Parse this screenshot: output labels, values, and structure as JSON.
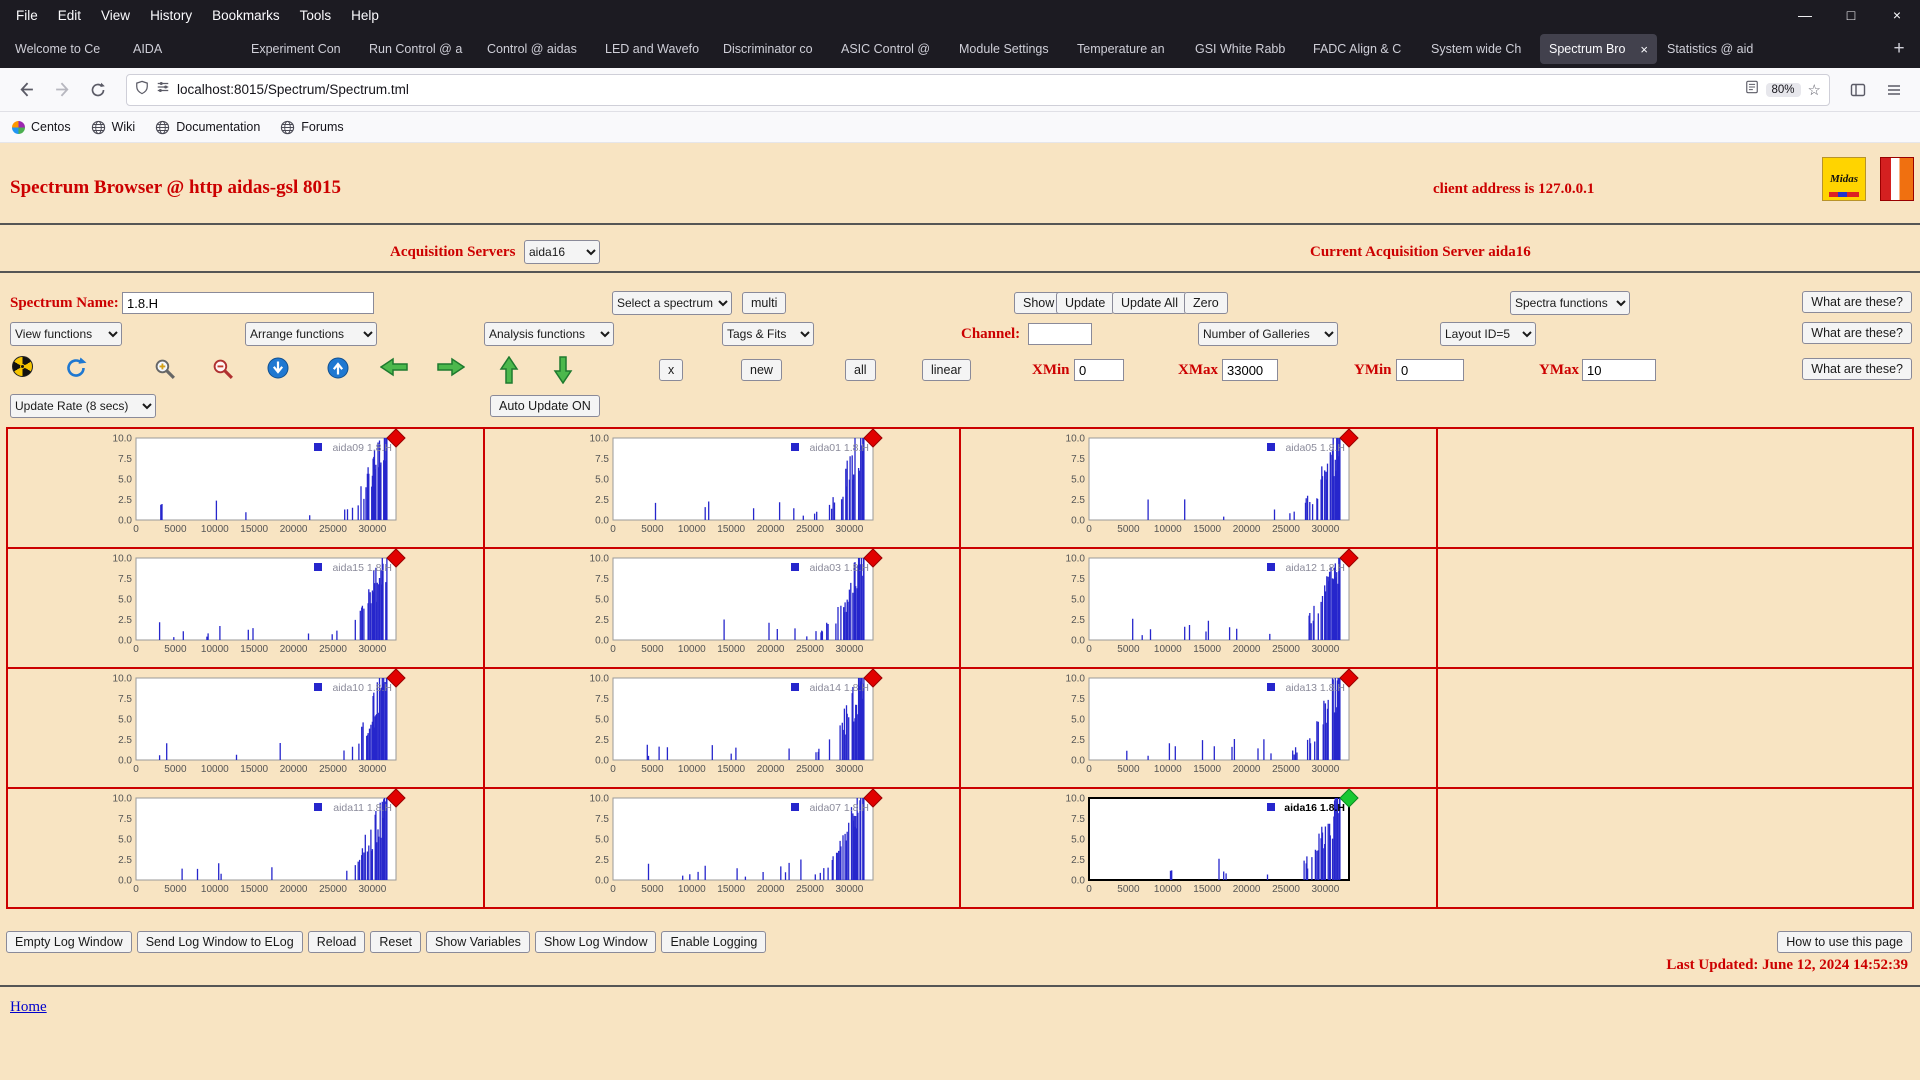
{
  "browser": {
    "menu": [
      "File",
      "Edit",
      "View",
      "History",
      "Bookmarks",
      "Tools",
      "Help"
    ],
    "window_controls": {
      "minimize": "—",
      "maximize": "□",
      "close": "×"
    },
    "tabs": [
      {
        "label": "Welcome to Ce"
      },
      {
        "label": "AIDA"
      },
      {
        "label": "Experiment Con"
      },
      {
        "label": "Run Control @ a"
      },
      {
        "label": "Control @ aidas"
      },
      {
        "label": "LED and Wavefo"
      },
      {
        "label": "Discriminator co"
      },
      {
        "label": "ASIC Control @"
      },
      {
        "label": "Module Settings"
      },
      {
        "label": "Temperature an"
      },
      {
        "label": "GSI White Rabb"
      },
      {
        "label": "FADC Align & C"
      },
      {
        "label": "System wide Ch"
      },
      {
        "label": "Spectrum Bro",
        "active": true
      },
      {
        "label": "Statistics @ aid"
      }
    ],
    "close_glyph": "×",
    "new_tab_button": "+",
    "nav": {
      "url": "localhost:8015/Spectrum/Spectrum.tml",
      "zoom_badge": "80%"
    },
    "bookmarks": [
      "Centos",
      "Wiki",
      "Documentation",
      "Forums"
    ]
  },
  "header": {
    "title": "Spectrum Browser @ http aidas-gsl 8015",
    "client": "client address is 127.0.0.1",
    "midas_logo_text": "Midas"
  },
  "servers": {
    "label": "Acquisition Servers",
    "selected_option": "aida16",
    "current_text": "Current Acquisition Server aida16"
  },
  "controls": {
    "spectrum_name_label": "Spectrum Name:",
    "spectrum_name_value": "1.8.H",
    "select_spectrum_option": "Select a spectrum",
    "multi_button": "multi",
    "show_button": "Show",
    "update_button": "Update",
    "update_all_button": "Update All",
    "zero_button": "Zero",
    "spectra_functions_option": "Spectra functions",
    "what_are_these_button": "What are these?",
    "view_functions_option": "View functions",
    "arrange_functions_option": "Arrange functions",
    "analysis_functions_option": "Analysis functions",
    "tags_fits_option": "Tags & Fits",
    "channel_label": "Channel:",
    "channel_value": "",
    "number_galleries_option": "Number of Galleries",
    "layout_id_option": "Layout ID=5",
    "x_button": "x",
    "new_button": "new",
    "all_button": "all",
    "linear_button": "linear",
    "xmin_label": "XMin",
    "xmin_value": "0",
    "xmax_label": "XMax",
    "xmax_value": "33000",
    "ymin_label": "YMin",
    "ymin_value": "0",
    "ymax_label": "YMax",
    "ymax_value": "10",
    "update_rate_option": "Update Rate (8 secs)",
    "auto_update_button": "Auto Update ON"
  },
  "footer": {
    "buttons": [
      "Empty Log Window",
      "Send Log Window to ELog",
      "Reload",
      "Reset",
      "Show Variables",
      "Show Log Window",
      "Enable Logging"
    ],
    "help_button": "How to use this page",
    "last_updated": "Last Updated: June 12, 2024 14:52:39",
    "home_link": "Home"
  },
  "chart_data": {
    "type": "bar",
    "title": "",
    "xlabel": "",
    "ylabel": "",
    "xlim": [
      0,
      33000
    ],
    "ylim": [
      0,
      10
    ],
    "x_ticks": [
      0,
      5000,
      10000,
      15000,
      20000,
      25000,
      30000
    ],
    "y_ticks": [
      10,
      7.5,
      5,
      2.5,
      0
    ],
    "bar_color": "#2626cc",
    "marker_red": "#e10000",
    "marker_green": "#18c832",
    "shape_note": "Each spectrum: sparse spikes of height 1-3 counts between x≈3000 and x≈26000, steep rise to the ymax of 10 between x≈26000 and x≈32000, zero beyond",
    "spectra": [
      {
        "name": "aida09 1.8.H",
        "seed": 9,
        "marker": "red"
      },
      {
        "name": "aida01 1.8.H",
        "seed": 1,
        "marker": "red"
      },
      {
        "name": "aida05 1.8.H",
        "seed": 5,
        "marker": "red"
      },
      {
        "name": "aida15 1.8.H",
        "seed": 15,
        "marker": "red"
      },
      {
        "name": "aida03 1.8.H",
        "seed": 3,
        "marker": "red"
      },
      {
        "name": "aida12 1.8.H",
        "seed": 12,
        "marker": "red"
      },
      {
        "name": "aida10 1.8.H",
        "seed": 10,
        "marker": "red"
      },
      {
        "name": "aida14 1.8.H",
        "seed": 14,
        "marker": "red"
      },
      {
        "name": "aida13 1.8.H",
        "seed": 13,
        "marker": "red"
      },
      {
        "name": "aida11 1.8.H",
        "seed": 11,
        "marker": "red"
      },
      {
        "name": "aida07 1.8.H",
        "seed": 7,
        "marker": "red"
      },
      {
        "name": "aida16 1.8.H",
        "seed": 16,
        "marker": "green",
        "selected": true
      }
    ],
    "grid": {
      "rows": 4,
      "cols": 4,
      "layout": [
        [
          0,
          1,
          2,
          null
        ],
        [
          3,
          4,
          5,
          null
        ],
        [
          6,
          7,
          8,
          null
        ],
        [
          9,
          10,
          11,
          null
        ]
      ]
    }
  }
}
